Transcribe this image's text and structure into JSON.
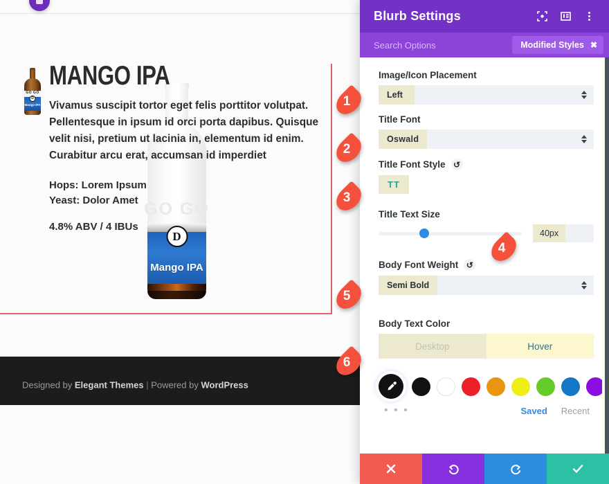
{
  "preview": {
    "blurb": {
      "title": "MANGO IPA",
      "description": "Vivamus suscipit tortor eget felis porttitor volutpat. Pellentesque in ipsum id orci porta dapibus. Quisque velit nisi, pretium ut lacinia in, elementum id enim. Curabitur arcu erat, accumsan id imperdiet",
      "hops": "Hops: Lorem Ipsum",
      "yeast": "Yeast: Dolor Amet",
      "abv": "4.8% ABV / 4 IBUs"
    },
    "bottle": {
      "brand": "GO GO",
      "monogram": "D",
      "name": "Mango IPA"
    },
    "footer": {
      "prefix": "Designed by ",
      "brand": "Elegant Themes",
      "separator": " | ",
      "powered_prefix": "Powered by ",
      "powered_brand": "WordPress"
    }
  },
  "callouts": [
    {
      "number": "1"
    },
    {
      "number": "2"
    },
    {
      "number": "3"
    },
    {
      "number": "4"
    },
    {
      "number": "5"
    },
    {
      "number": "6"
    }
  ],
  "panel": {
    "title": "Blurb Settings",
    "header_icons": [
      "focus-frame-icon",
      "layout-columns-icon",
      "vertical-dots-icon"
    ],
    "search": {
      "placeholder": "Search Options",
      "badge_label": "Modified Styles",
      "badge_close": "✖"
    },
    "fields": {
      "placement": {
        "label": "Image/Icon Placement",
        "value": "Left"
      },
      "title_font": {
        "label": "Title Font",
        "value": "Oswald"
      },
      "title_font_style": {
        "label": "Title Font Style",
        "button": "TT"
      },
      "title_text_size": {
        "label": "Title Text Size",
        "value": "40px",
        "slider_percent": 32
      },
      "body_font_weight": {
        "label": "Body Font Weight",
        "value": "Semi Bold"
      },
      "body_text_color": {
        "label": "Body Text Color",
        "tab_desktop": "Desktop",
        "tab_hover": "Hover"
      }
    },
    "swatches": [
      {
        "name": "eyedropper",
        "color": "#111111"
      },
      {
        "name": "black",
        "color": "#111111"
      },
      {
        "name": "white",
        "color": "#ffffff"
      },
      {
        "name": "red",
        "color": "#ec2027"
      },
      {
        "name": "orange",
        "color": "#e89611"
      },
      {
        "name": "yellow",
        "color": "#eeee17"
      },
      {
        "name": "green",
        "color": "#63cc29"
      },
      {
        "name": "blue",
        "color": "#1476c4"
      },
      {
        "name": "purple",
        "color": "#8d0ee0"
      },
      {
        "name": "none",
        "color": "transparent"
      }
    ],
    "color_meta": {
      "more": "• • •",
      "saved": "Saved",
      "recent": "Recent"
    },
    "actions": {
      "cancel": "cancel-button",
      "undo": "undo-button",
      "redo": "redo-button",
      "save": "save-button"
    }
  },
  "colors": {
    "panel_header": "#7331c6",
    "panel_search": "#8b43d8",
    "accent_value_bg": "#ece9cf",
    "hover_tab_bg": "#fdf7cf",
    "callout": "#f4503c",
    "modified_border": "#d8636f"
  }
}
